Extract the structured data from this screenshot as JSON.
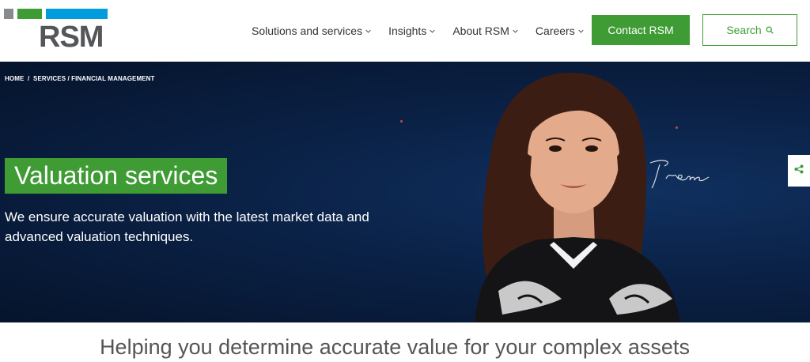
{
  "header": {
    "logo_text": "RSM",
    "nav": [
      {
        "label": "Solutions and services"
      },
      {
        "label": "Insights"
      },
      {
        "label": "About RSM"
      },
      {
        "label": "Careers"
      }
    ],
    "contact_label": "Contact RSM",
    "search_label": "Search",
    "icons": {
      "chevron": "chevron-down-icon",
      "search": "search-icon",
      "share": "share-icon"
    }
  },
  "breadcrumb": {
    "home": "HOME",
    "sep1": "  /  ",
    "services": "SERVICES",
    "sep2": " / ",
    "current": "FINANCIAL MANAGEMENT"
  },
  "hero": {
    "title": "Valuation services",
    "description": "We ensure accurate valuation with the latest market data and advanced valuation techniques.",
    "signature": "Irene"
  },
  "section": {
    "heading": "Helping you determine accurate value for your complex assets"
  },
  "colors": {
    "brand_green": "#3f9c35",
    "brand_blue": "#009cde",
    "brand_gray": "#888b8d",
    "hero_navy": "#0b2349"
  }
}
